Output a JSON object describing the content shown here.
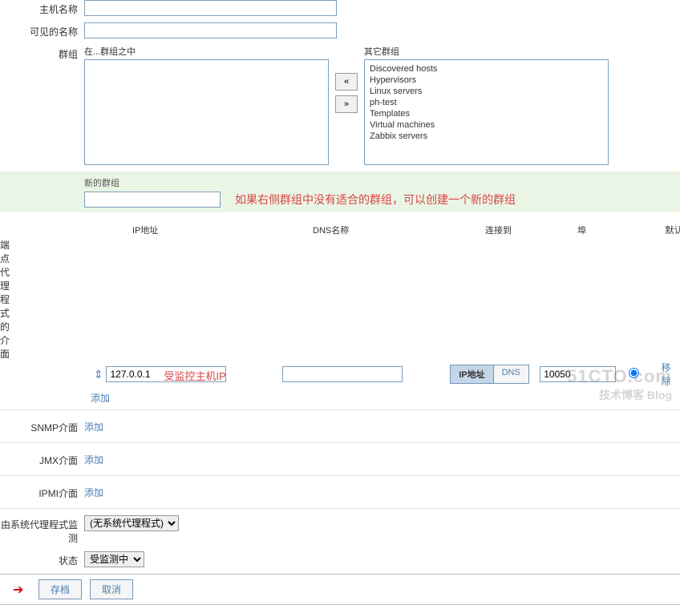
{
  "labels": {
    "hostname": "主机名称",
    "visiblename": "可见的名称",
    "groups": "群组",
    "in_groups": "在...群组之中",
    "other_groups": "其它群组",
    "new_group": "新的群组",
    "agent_iface": "端点代理程式的介面",
    "ip_addr": "IP地址",
    "dns_name": "DNS名称",
    "connect_to": "连接到",
    "port": "埠",
    "default": "默认",
    "add": "添加",
    "remove": "移除",
    "snmp_iface": "SNMP介面",
    "jmx_iface": "JMX介面",
    "ipmi_iface": "IPMI介面",
    "monitored_by": "由系统代理程式监测",
    "status": "状态"
  },
  "values": {
    "hostname": "",
    "visiblename": "",
    "new_group": "",
    "ip": "127.0.0.1",
    "dns": "",
    "port": "10050"
  },
  "annotations": {
    "new_group_hint": "如果右侧群组中没有适合的群组，可以创建一个新的群组",
    "ip_hint": "受监控主机IP"
  },
  "other_groups_options": [
    "Discovered hosts",
    "Hypervisors",
    "Linux servers",
    "ph-test",
    "Templates",
    "Virtual machines",
    "Zabbix servers"
  ],
  "toggle": {
    "ip": "IP地址",
    "dns": "DNS"
  },
  "selects": {
    "proxy": "(无系统代理程式)",
    "status": "受监测中"
  },
  "buttons": {
    "save": "存档",
    "cancel": "取消",
    "left": "«",
    "right": "»"
  },
  "watermark": {
    "top": "51CTO.com",
    "bot": "技术博客  Blog"
  }
}
